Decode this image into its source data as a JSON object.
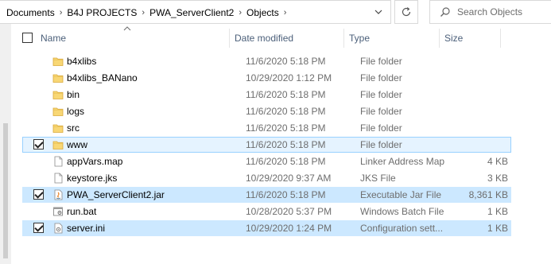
{
  "address": {
    "breadcrumbs": [
      "Documents",
      "B4J PROJECTS",
      "PWA_ServerClient2",
      "Objects"
    ],
    "search_placeholder": "Search Objects"
  },
  "columns": {
    "name": "Name",
    "date": "Date modified",
    "type": "Type",
    "size": "Size"
  },
  "files": [
    {
      "name": "b4xlibs",
      "date": "11/6/2020 5:18 PM",
      "type": "File folder",
      "size": "",
      "icon": "folder-icon",
      "checked": false,
      "state": "normal"
    },
    {
      "name": "b4xlibs_BANano",
      "date": "10/29/2020 1:12 PM",
      "type": "File folder",
      "size": "",
      "icon": "folder-icon",
      "checked": false,
      "state": "normal"
    },
    {
      "name": "bin",
      "date": "11/6/2020 5:18 PM",
      "type": "File folder",
      "size": "",
      "icon": "folder-icon",
      "checked": false,
      "state": "normal"
    },
    {
      "name": "logs",
      "date": "11/6/2020 5:18 PM",
      "type": "File folder",
      "size": "",
      "icon": "folder-icon",
      "checked": false,
      "state": "normal"
    },
    {
      "name": "src",
      "date": "11/6/2020 5:18 PM",
      "type": "File folder",
      "size": "",
      "icon": "folder-icon",
      "checked": false,
      "state": "normal"
    },
    {
      "name": "www",
      "date": "11/6/2020 5:18 PM",
      "type": "File folder",
      "size": "",
      "icon": "folder-icon",
      "checked": true,
      "state": "focus"
    },
    {
      "name": "appVars.map",
      "date": "11/6/2020 5:18 PM",
      "type": "Linker Address Map",
      "size": "4 KB",
      "icon": "file-icon",
      "checked": false,
      "state": "normal"
    },
    {
      "name": "keystore.jks",
      "date": "10/29/2020 9:37 AM",
      "type": "JKS File",
      "size": "3 KB",
      "icon": "file-icon",
      "checked": false,
      "state": "normal"
    },
    {
      "name": "PWA_ServerClient2.jar",
      "date": "11/6/2020 5:18 PM",
      "type": "Executable Jar File",
      "size": "8,361 KB",
      "icon": "java-jar-icon",
      "checked": true,
      "state": "sel"
    },
    {
      "name": "run.bat",
      "date": "10/28/2020 5:37 PM",
      "type": "Windows Batch File",
      "size": "1 KB",
      "icon": "batch-file-icon",
      "checked": false,
      "state": "normal"
    },
    {
      "name": "server.ini",
      "date": "10/29/2020 1:24 PM",
      "type": "Configuration sett...",
      "size": "1 KB",
      "icon": "settings-file-icon",
      "checked": true,
      "state": "sel"
    }
  ],
  "colors": {
    "selected_row": "#cce8ff",
    "focused_row": "#e5f3ff",
    "focus_border": "#99d1ff",
    "folder": "#f8d775"
  }
}
